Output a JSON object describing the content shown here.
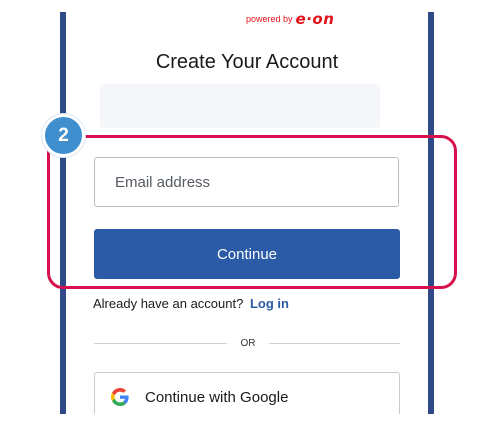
{
  "header": {
    "powered_by": "powered by",
    "brand": "e·on"
  },
  "title": "Create Your Account",
  "step_badge": "2",
  "form": {
    "email_placeholder": "Email address",
    "email_value": "",
    "continue_label": "Continue"
  },
  "login": {
    "prompt": "Already have an account?",
    "link_label": "Log in"
  },
  "divider_text": "OR",
  "social": {
    "google_label": "Continue with Google",
    "google_icon": "google-icon"
  },
  "colors": {
    "frame": "#2f4a86",
    "brand_red": "#e2141b",
    "highlight": "#d6114d",
    "badge": "#3f8fcf",
    "primary_button": "#2b5aa6"
  }
}
